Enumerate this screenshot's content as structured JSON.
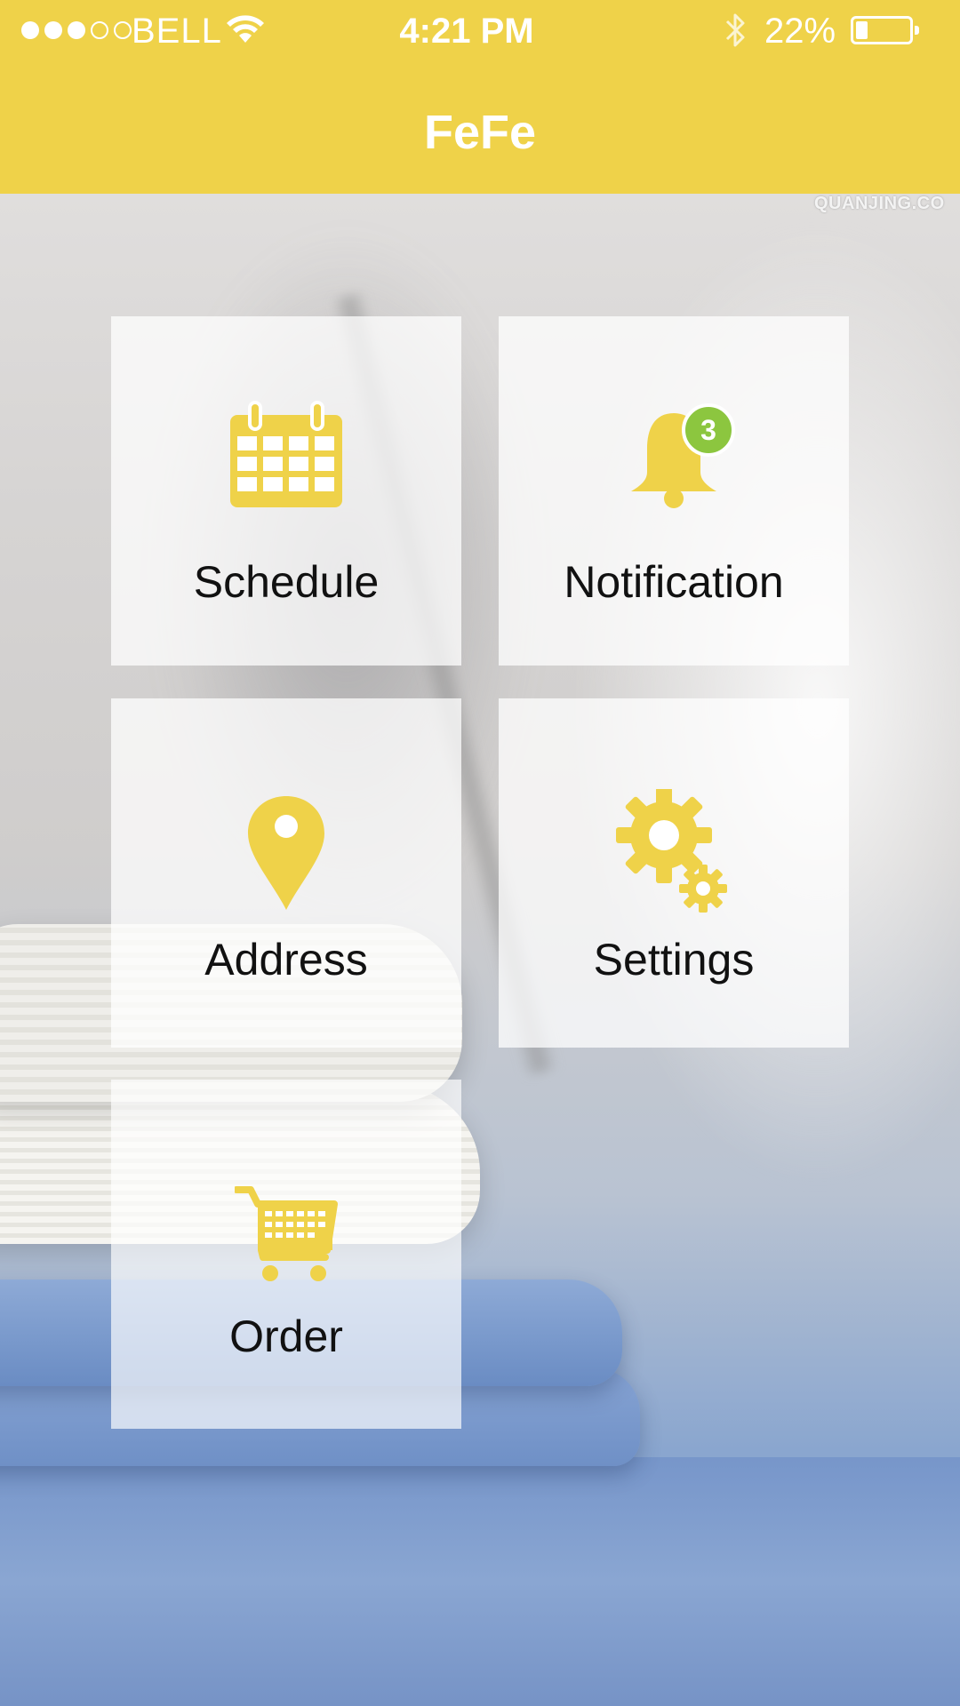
{
  "status_bar": {
    "carrier": "BELL",
    "time": "4:21 PM",
    "battery_percent": "22%",
    "signal_bars_filled": 3,
    "signal_bars_total": 5,
    "battery_level": 0.22
  },
  "header": {
    "title": "FeFe"
  },
  "watermark": "QUANJING.CO",
  "menu": {
    "schedule": {
      "label": "Schedule",
      "icon": "calendar-icon"
    },
    "notification": {
      "label": "Notification",
      "icon": "bell-icon",
      "badge": "3"
    },
    "address": {
      "label": "Address",
      "icon": "location-pin-icon"
    },
    "settings": {
      "label": "Settings",
      "icon": "gear-icon"
    },
    "order": {
      "label": "Order",
      "icon": "shopping-cart-icon"
    }
  },
  "colors": {
    "header_yellow": "#efd249",
    "icon_yellow": "#efd249",
    "badge_green": "#8cc63f",
    "tile_text": "#111111"
  }
}
